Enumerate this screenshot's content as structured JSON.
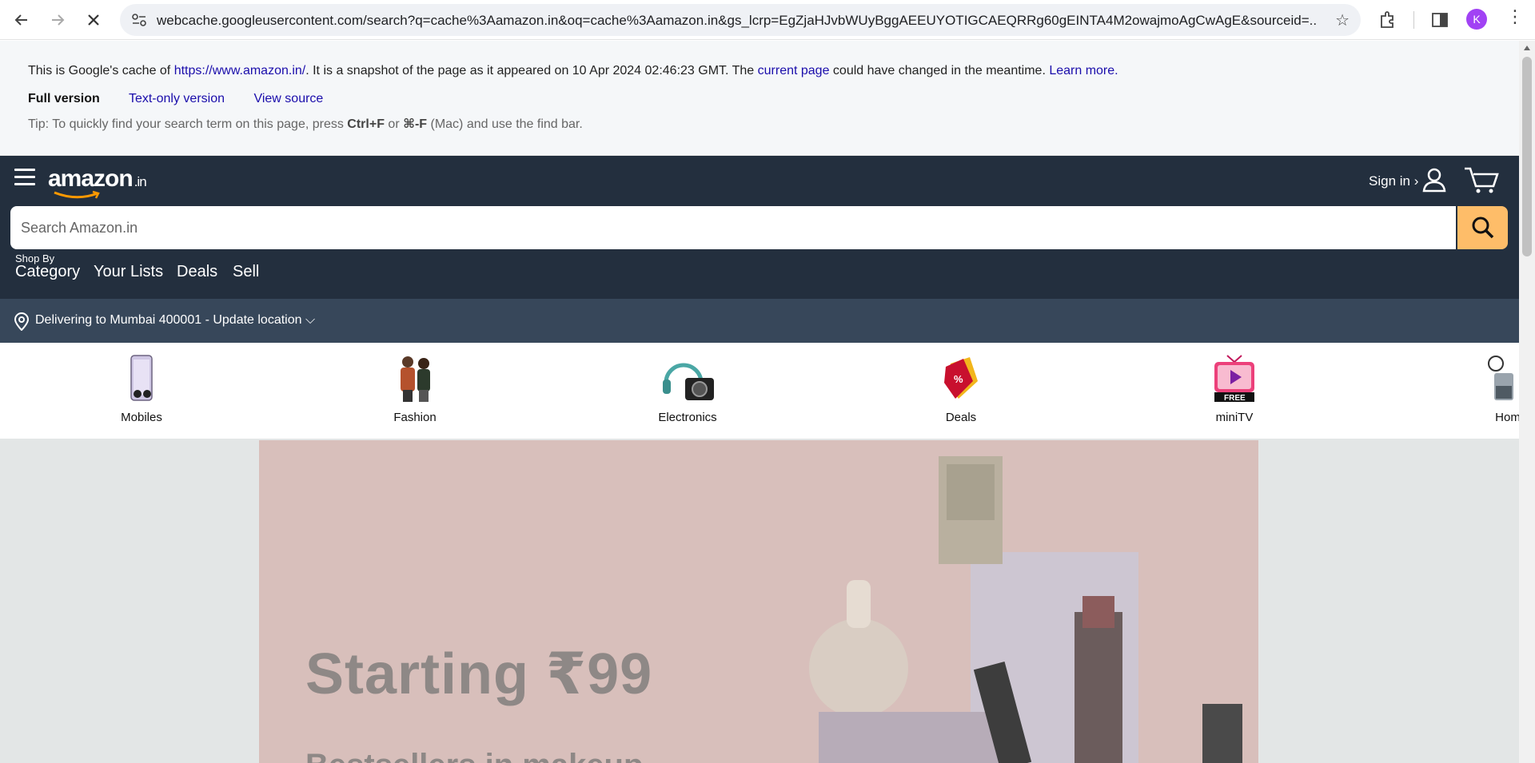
{
  "browser": {
    "url": "webcache.googleusercontent.com/search?q=cache%3Aamazon.in&oq=cache%3Aamazon.in&gs_lcrp=EgZjaHJvbWUyBggAEEUYOTIGCAEQRRg60gEINTA4M2owajmoAgCwAgE&sourceid=...",
    "profile_initial": "K"
  },
  "cache_banner": {
    "prefix": "This is Google's cache of ",
    "cached_url": "https://www.amazon.in/",
    "middle": ". It is a snapshot of the page as it appeared on 10 Apr 2024 02:46:23 GMT. The ",
    "current_page": "current page",
    "suffix": " could have changed in the meantime. ",
    "learn_more": "Learn more.",
    "full_version": "Full version",
    "text_only": "Text-only version",
    "view_source": "View source",
    "tip_prefix": "Tip: To quickly find your search term on this page, press ",
    "tip_key1": "Ctrl+F",
    "tip_or": " or ",
    "tip_key2": "⌘-F",
    "tip_suffix": " (Mac) and use the find bar."
  },
  "amazon": {
    "logo": "amazon",
    "logo_tld": ".in",
    "sign_in": "Sign in ›",
    "search_placeholder": "Search Amazon.in",
    "shop_by": "Shop By",
    "nav": [
      "Category",
      "Your Lists",
      "Deals",
      "Sell"
    ],
    "delivery": "Delivering to Mumbai 400001 - Update location ⌵",
    "categories": [
      "Mobiles",
      "Fashion",
      "Electronics",
      "Deals",
      "miniTV",
      "Hom"
    ],
    "hero_text": "Starting ₹99",
    "hero_sub": "Bestsellers in makeup"
  },
  "colors": {
    "header": "#232f3e",
    "delivery_bar": "#37475a",
    "search_button": "#febd69",
    "link": "#1a0dab"
  }
}
